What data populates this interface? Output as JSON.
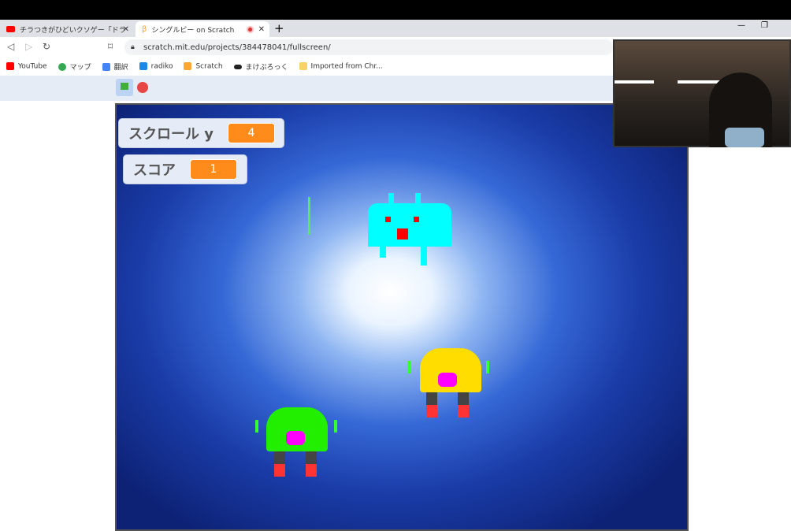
{
  "browser": {
    "tabs": [
      {
        "title": "チラつきがひどいクソゲー「ドラえもんカー",
        "active": false,
        "icon": "youtube-icon"
      },
      {
        "title": "シングルビー on Scratch",
        "active": true,
        "icon": "scratch-icon"
      }
    ],
    "url": "scratch.mit.edu/projects/384478041/fullscreen/",
    "bookmarks": [
      {
        "label": "YouTube",
        "color": "#ff0000"
      },
      {
        "label": "マップ",
        "color": "#34a853"
      },
      {
        "label": "翻訳",
        "color": "#4285f4"
      },
      {
        "label": "radiko",
        "color": "#1e88e5"
      },
      {
        "label": "Scratch",
        "color": "#f7a733"
      },
      {
        "label": "まけぷろっく",
        "color": "#222222"
      },
      {
        "label": "Imported from Chr...",
        "color": "#f6d365"
      }
    ]
  },
  "scratch": {
    "monitors": [
      {
        "label": "スクロール y",
        "value": "4"
      },
      {
        "label": "スコア",
        "value": "1"
      }
    ],
    "accent": "#ff8c1a"
  }
}
